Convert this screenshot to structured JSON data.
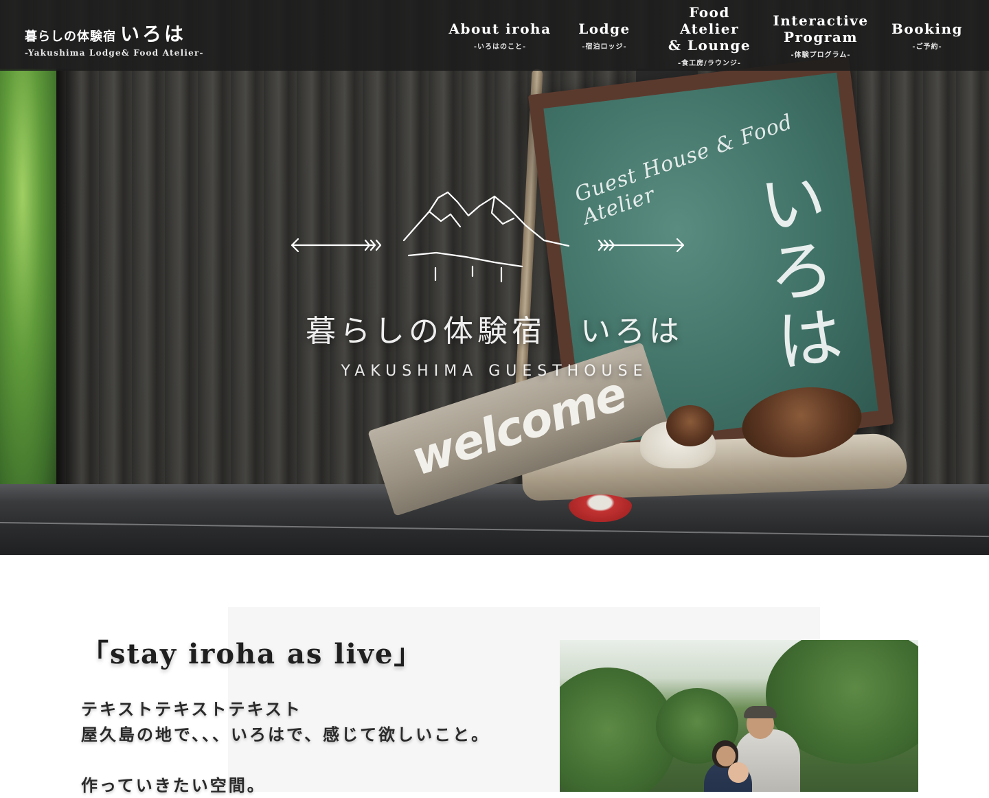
{
  "header": {
    "brand_main": "暮らしの体験宿",
    "brand_accent": "いろは",
    "brand_sub": "-Yakushima Lodge& Food Atelier-",
    "nav": [
      {
        "label": "About iroha",
        "sub": "-いろはのこと-"
      },
      {
        "label": "Lodge",
        "sub": "-宿泊ロッジ-"
      },
      {
        "label": "Food Atelier\n& Lounge",
        "sub": "-食工房/ラウンジ-"
      },
      {
        "label": "Interactive\nProgram",
        "sub": "-体験プログラム-"
      },
      {
        "label": "Booking",
        "sub": "-ご予約-"
      }
    ]
  },
  "hero": {
    "title": "暮らしの体験宿　いろは",
    "subtitle": "YAKUSHIMA GUESTHOUSE",
    "board_text_en": "Guest House & Food Atelier",
    "board_text_jp": "いろは",
    "welcome_text": "welcome",
    "logo_icon": "mountain-arrows-logo"
  },
  "concept": {
    "heading": "「stay iroha as live」",
    "lines": [
      "テキストテキストテキスト",
      "屋久島の地で、、、いろはで、感じて欲しいこと。",
      "",
      "作っていきたい空間。"
    ],
    "photo_icon": "family-photo"
  },
  "colors": {
    "header_bg": "#1c1c1c",
    "section_bg": "#f6f6f6",
    "text": "#222222"
  }
}
